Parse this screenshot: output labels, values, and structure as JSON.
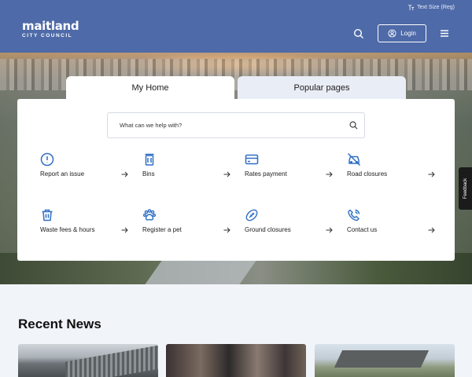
{
  "header": {
    "logo_main": "maitland",
    "logo_sub": "CITY COUNCIL",
    "text_size_label": "Text Size (Reg)",
    "login_label": "Login",
    "search_icon": "search-icon",
    "menu_icon": "hamburger-menu-icon",
    "background_color": "#4e6aa8"
  },
  "tabs": [
    {
      "label": "My Home",
      "active": true
    },
    {
      "label": "Popular pages",
      "active": false
    }
  ],
  "search": {
    "placeholder": "What can we help with?"
  },
  "quick_links": [
    {
      "label": "Report an issue",
      "icon": "alert-circle-icon"
    },
    {
      "label": "Bins",
      "icon": "bin-icon"
    },
    {
      "label": "Rates payment",
      "icon": "credit-card-icon"
    },
    {
      "label": "Road closures",
      "icon": "car-off-icon"
    },
    {
      "label": "Waste fees & hours",
      "icon": "trash-icon"
    },
    {
      "label": "Register a pet",
      "icon": "paw-icon"
    },
    {
      "label": "Ground closures",
      "icon": "football-icon"
    },
    {
      "label": "Contact us",
      "icon": "phone-icon"
    }
  ],
  "feedback_label": "Feedback",
  "news": {
    "title": "Recent News"
  },
  "accent_color": "#2f6fc4"
}
